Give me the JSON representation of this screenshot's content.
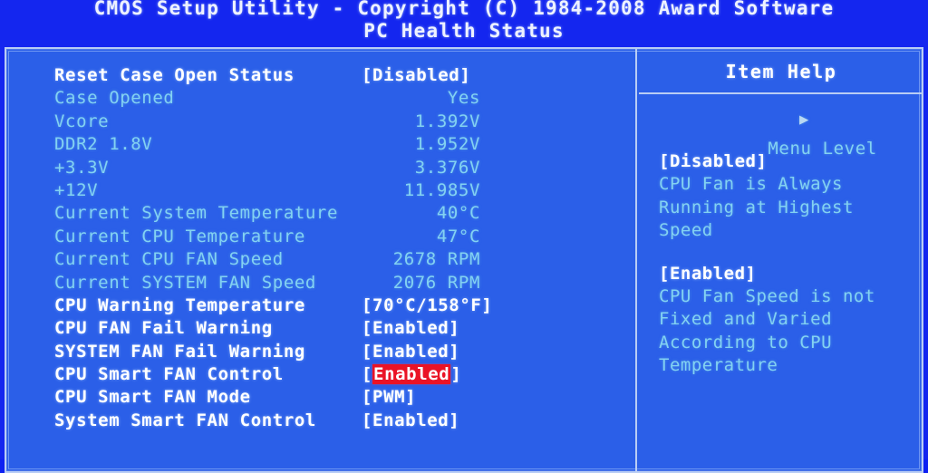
{
  "header": {
    "line1": "CMOS Setup Utility - Copyright (C) 1984-2008 Award Software",
    "line2": "PC Health Status"
  },
  "colors": {
    "background": "#1426ef",
    "panel": "#2b5fe8",
    "border": "#b9cdf5",
    "option_text": "#ffffff",
    "readonly_text": "#83d2f2",
    "highlight_bg": "#ea1326",
    "highlight_text": "#ffffff"
  },
  "settings": {
    "rows": [
      {
        "label": "Reset Case Open Status",
        "value": "[Disabled]",
        "type": "option",
        "selected": false
      },
      {
        "label": "Case Opened",
        "value": "Yes",
        "type": "readonly",
        "selected": false
      },
      {
        "label": "Vcore",
        "value": "1.392V",
        "type": "readonly",
        "selected": false
      },
      {
        "label": "DDR2 1.8V",
        "value": "1.952V",
        "type": "readonly",
        "selected": false
      },
      {
        "label": "+3.3V",
        "value": "3.376V",
        "type": "readonly",
        "selected": false
      },
      {
        "label": "+12V",
        "value": "11.985V",
        "type": "readonly",
        "selected": false
      },
      {
        "label": "Current System Temperature",
        "value": "40°C",
        "type": "readonly",
        "selected": false
      },
      {
        "label": "Current CPU Temperature",
        "value": "47°C",
        "type": "readonly",
        "selected": false
      },
      {
        "label": "Current CPU FAN Speed",
        "value": "2678 RPM",
        "type": "readonly",
        "selected": false
      },
      {
        "label": "Current SYSTEM FAN Speed",
        "value": "2076 RPM",
        "type": "readonly",
        "selected": false
      },
      {
        "label": "CPU Warning Temperature",
        "value": "[70°C/158°F]",
        "type": "option",
        "selected": false
      },
      {
        "label": "CPU FAN Fail Warning",
        "value": "[Enabled]",
        "type": "option",
        "selected": false
      },
      {
        "label": "SYSTEM FAN Fail Warning",
        "value": "[Enabled]",
        "type": "option",
        "selected": false
      },
      {
        "label": "CPU Smart FAN Control",
        "value": "[Enabled]",
        "type": "option",
        "selected": true,
        "value_prefix": "[",
        "value_highlight": "Enabled",
        "value_suffix": "]"
      },
      {
        "label": "CPU Smart FAN Mode",
        "value": "[PWM]",
        "type": "option",
        "selected": false
      },
      {
        "label": "System Smart FAN Control",
        "value": "[Enabled]",
        "type": "option",
        "selected": false
      }
    ]
  },
  "item_help": {
    "title": "Item Help",
    "menu_level_label": "Menu Level",
    "menu_level_arrow": "▶",
    "blocks": [
      {
        "heading": "[Disabled]",
        "lines": [
          "CPU Fan is Always",
          "Running at Highest",
          "Speed"
        ]
      },
      {
        "heading": "[Enabled]",
        "lines": [
          "CPU Fan Speed is not",
          "Fixed and Varied",
          "According to CPU",
          "Temperature"
        ]
      }
    ]
  }
}
